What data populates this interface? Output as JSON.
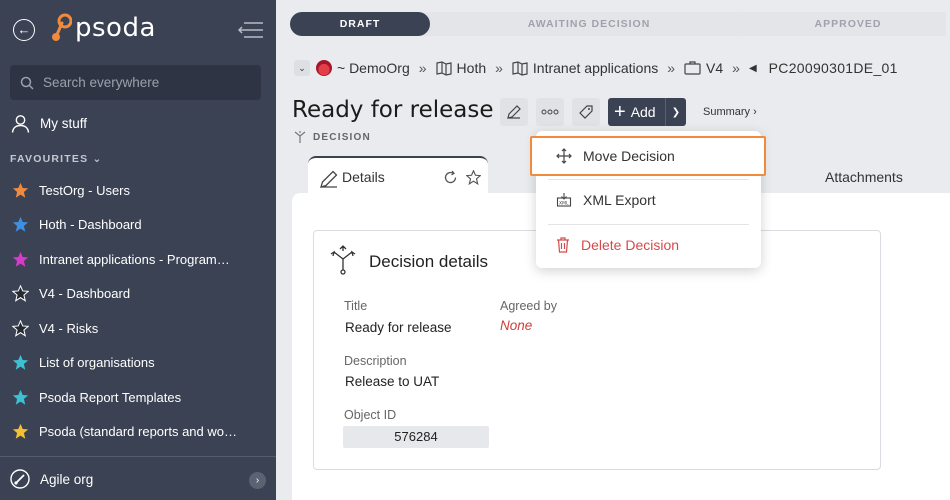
{
  "sidebar": {
    "logo_text": "psoda",
    "search_placeholder": "Search everywhere",
    "my_stuff": "My stuff",
    "favourites_header": "FAVOURITES",
    "favourites": [
      {
        "label": "TestOrg - Users",
        "color": "#f08a3c"
      },
      {
        "label": "Hoth - Dashboard",
        "color": "#3e8fe0"
      },
      {
        "label": "Intranet applications - Programme...",
        "color": "#d63ac7"
      },
      {
        "label": "V4 - Dashboard",
        "color": "#262a33"
      },
      {
        "label": "V4 - Risks",
        "color": "#262a33"
      },
      {
        "label": "List of organisations",
        "color": "#3bc1d3"
      },
      {
        "label": "Psoda Report Templates",
        "color": "#3bc1d3"
      },
      {
        "label": "Psoda (standard reports and work...",
        "color": "#f2c230"
      }
    ],
    "bottom_org": "Agile org"
  },
  "progress": {
    "steps": [
      "DRAFT",
      "AWAITING DECISION",
      "APPROVED"
    ]
  },
  "breadcrumb": {
    "org": "~ DemoOrg",
    "items": [
      "Hoth",
      "Intranet applications",
      "V4"
    ],
    "current_id": "PC20090301DE_01"
  },
  "header": {
    "title": "Ready for release",
    "add_label": "Add",
    "summary_link": "Summary ›",
    "object_type": "DECISION"
  },
  "tabs": {
    "details": "Details",
    "attachments": "Attachments"
  },
  "menu": {
    "items": [
      "Move Decision",
      "XML Export",
      "Delete Decision"
    ]
  },
  "details": {
    "card_title": "Decision details",
    "title_label": "Title",
    "title_value": "Ready for release",
    "agreed_label": "Agreed by",
    "agreed_value": "None",
    "description_label": "Description",
    "description_value": "Release to UAT",
    "object_id_label": "Object ID",
    "object_id_value": "576284"
  },
  "colors": {
    "sidebar": "#3b4253",
    "highlight": "#f08a3c",
    "danger": "#d34b4b",
    "logo_accent": "#f08a3c"
  }
}
